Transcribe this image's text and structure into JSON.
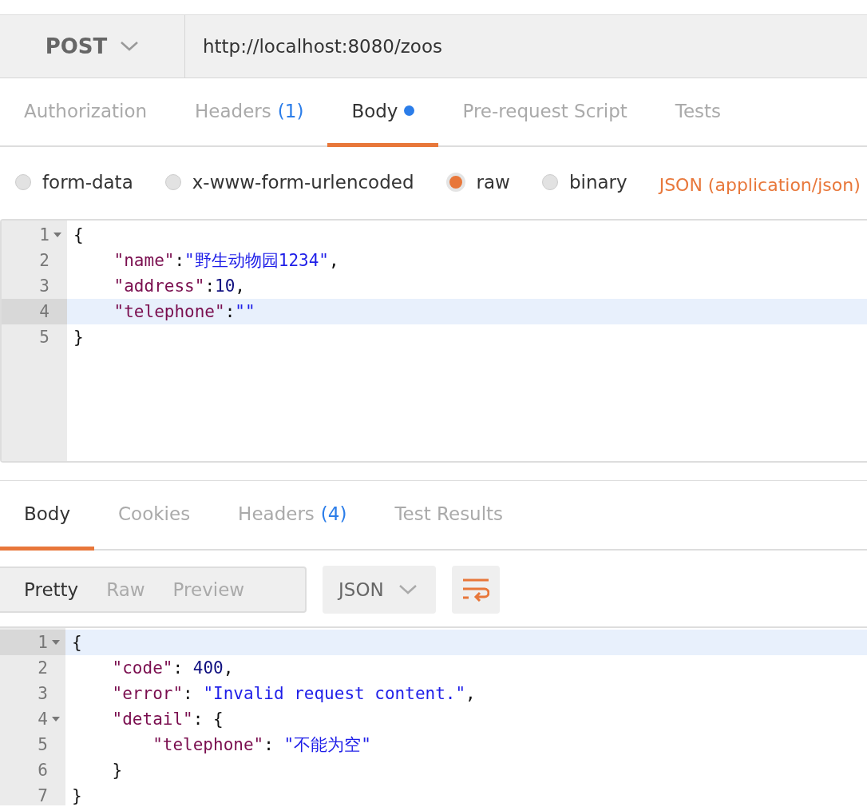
{
  "request": {
    "method": "POST",
    "url": "http://localhost:8080/zoos"
  },
  "request_tabs": [
    {
      "label": "Authorization",
      "selected": false
    },
    {
      "label": "Headers",
      "count": "(1)",
      "selected": false
    },
    {
      "label": "Body",
      "selected": true,
      "dot": true
    },
    {
      "label": "Pre-request Script",
      "selected": false
    },
    {
      "label": "Tests",
      "selected": false
    }
  ],
  "body_modes": [
    {
      "label": "form-data",
      "selected": false
    },
    {
      "label": "x-www-form-urlencoded",
      "selected": false
    },
    {
      "label": "raw",
      "selected": true
    },
    {
      "label": "binary",
      "selected": false
    }
  ],
  "content_type": "JSON (application/json)",
  "request_editor": {
    "lines": [
      {
        "number": "1",
        "fold": true,
        "active": false,
        "tokens": [
          {
            "kind": "punct",
            "text": "{"
          }
        ]
      },
      {
        "number": "2",
        "fold": false,
        "active": false,
        "tokens": [
          {
            "kind": "key",
            "text": "    \"name\""
          },
          {
            "kind": "punct",
            "text": ":"
          },
          {
            "kind": "string",
            "text": "\"野生动物园1234\""
          },
          {
            "kind": "punct",
            "text": ","
          }
        ]
      },
      {
        "number": "3",
        "fold": false,
        "active": false,
        "tokens": [
          {
            "kind": "key",
            "text": "    \"address\""
          },
          {
            "kind": "punct",
            "text": ":"
          },
          {
            "kind": "number",
            "text": "10"
          },
          {
            "kind": "punct",
            "text": ","
          }
        ]
      },
      {
        "number": "4",
        "fold": false,
        "active": true,
        "tokens": [
          {
            "kind": "key",
            "text": "    \"telephone\""
          },
          {
            "kind": "punct",
            "text": ":"
          },
          {
            "kind": "string",
            "text": "\"\""
          }
        ]
      },
      {
        "number": "5",
        "fold": false,
        "active": false,
        "tokens": [
          {
            "kind": "punct",
            "text": "}"
          }
        ]
      }
    ]
  },
  "response_tabs": [
    {
      "label": "Body",
      "selected": true
    },
    {
      "label": "Cookies",
      "selected": false
    },
    {
      "label": "Headers",
      "count": "(4)",
      "selected": false
    },
    {
      "label": "Test Results",
      "selected": false
    }
  ],
  "view_modes": [
    {
      "label": "Pretty",
      "selected": true
    },
    {
      "label": "Raw",
      "selected": false
    },
    {
      "label": "Preview",
      "selected": false
    }
  ],
  "format": "JSON",
  "response_editor": {
    "lines": [
      {
        "number": "1",
        "fold": true,
        "active": true,
        "tokens": [
          {
            "kind": "punct",
            "text": "{"
          }
        ]
      },
      {
        "number": "2",
        "fold": false,
        "active": false,
        "tokens": [
          {
            "kind": "key",
            "text": "    \"code\""
          },
          {
            "kind": "punct",
            "text": ": "
          },
          {
            "kind": "number",
            "text": "400"
          },
          {
            "kind": "punct",
            "text": ","
          }
        ]
      },
      {
        "number": "3",
        "fold": false,
        "active": false,
        "tokens": [
          {
            "kind": "key",
            "text": "    \"error\""
          },
          {
            "kind": "punct",
            "text": ": "
          },
          {
            "kind": "string",
            "text": "\"Invalid request content.\""
          },
          {
            "kind": "punct",
            "text": ","
          }
        ]
      },
      {
        "number": "4",
        "fold": true,
        "active": false,
        "tokens": [
          {
            "kind": "key",
            "text": "    \"detail\""
          },
          {
            "kind": "punct",
            "text": ": {"
          }
        ]
      },
      {
        "number": "5",
        "fold": false,
        "active": false,
        "tokens": [
          {
            "kind": "key",
            "text": "        \"telephone\""
          },
          {
            "kind": "punct",
            "text": ": "
          },
          {
            "kind": "string",
            "text": "\"不能为空\""
          }
        ]
      },
      {
        "number": "6",
        "fold": false,
        "active": false,
        "tokens": [
          {
            "kind": "punct",
            "text": "    }"
          }
        ]
      },
      {
        "number": "7",
        "fold": false,
        "active": false,
        "tokens": [
          {
            "kind": "punct",
            "text": "}"
          }
        ]
      }
    ]
  }
}
